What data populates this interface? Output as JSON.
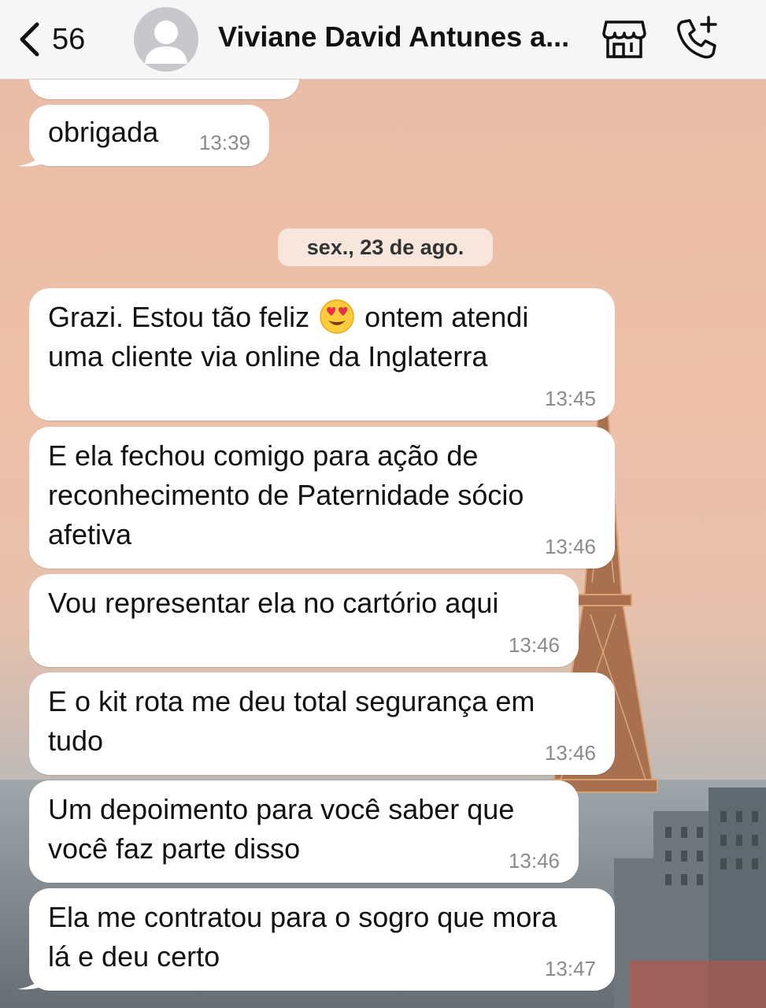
{
  "header": {
    "back_count": "56",
    "contact_name": "Viviane David Antunes a...",
    "icons": [
      "chevron-left-icon",
      "avatar-placeholder-icon",
      "store-icon",
      "phone-add-icon"
    ]
  },
  "chat": {
    "previous_messages": [
      {
        "text": "obrigada",
        "time": "13:39"
      }
    ],
    "date_separator": "sex., 23 de ago.",
    "messages": [
      {
        "text_before_emoji": "Grazi. Estou tão feliz",
        "emoji": "heart-eyes-emoji",
        "text_after_emoji": "ontem atendi",
        "text_line2": "uma cliente via online da Inglaterra",
        "time": "13:45"
      },
      {
        "lines": [
          "E ela fechou comigo para ação de",
          "reconhecimento de Paternidade sócio",
          "afetiva"
        ],
        "time": "13:46"
      },
      {
        "lines": [
          "Vou representar ela no cartório aqui"
        ],
        "time": "13:46"
      },
      {
        "lines": [
          "E o kit rota me deu total segurança em",
          "tudo"
        ],
        "time": "13:46"
      },
      {
        "lines": [
          "Um depoimento para você saber que",
          "você faz parte disso"
        ],
        "time": "13:46"
      },
      {
        "lines": [
          "Ela me contratou para o sogro que mora",
          "lá e deu certo"
        ],
        "time": "13:47"
      }
    ]
  },
  "colors": {
    "header_bg": "#f6f6f6",
    "bubble_bg": "#ffffff",
    "timestamp": "#8b8b8b",
    "date_pill_bg": "#f7e6dc",
    "wallpaper_top": "#e9bca7"
  }
}
